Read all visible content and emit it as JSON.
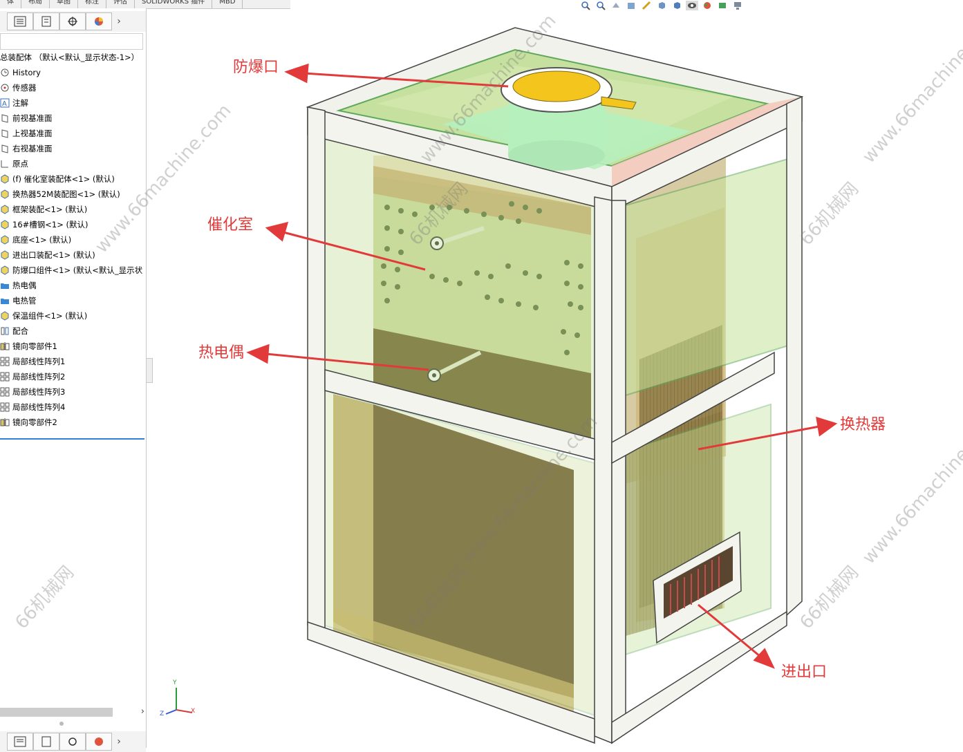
{
  "tabs": [
    "体",
    "布局",
    "草图",
    "标注",
    "评估",
    "SOLIDWORKS 插件",
    "MBD"
  ],
  "feature_tree": {
    "root": "总装配体 （默认<默认_显示状态-1>）",
    "items": [
      {
        "label": "History",
        "icon": "history-icon"
      },
      {
        "label": "传感器",
        "icon": "sensor-icon"
      },
      {
        "label": "注解",
        "icon": "annotation-icon"
      },
      {
        "label": "前视基准面",
        "icon": "plane-icon"
      },
      {
        "label": "上视基准面",
        "icon": "plane-icon"
      },
      {
        "label": "右视基准面",
        "icon": "plane-icon"
      },
      {
        "label": "原点",
        "icon": "origin-icon"
      },
      {
        "label": "(f) 催化室装配体<1> (默认)",
        "icon": "assembly-icon"
      },
      {
        "label": "换热器52M装配图<1> (默认)",
        "icon": "assembly-icon"
      },
      {
        "label": "框架装配<1> (默认)",
        "icon": "assembly-icon"
      },
      {
        "label": "16#槽钢<1> (默认)",
        "icon": "part-icon"
      },
      {
        "label": "底座<1> (默认)",
        "icon": "assembly-icon"
      },
      {
        "label": "进出口装配<1> (默认)",
        "icon": "assembly-icon"
      },
      {
        "label": "防爆口组件<1> (默认<默认_显示状",
        "icon": "assembly-icon"
      },
      {
        "label": "热电偶",
        "icon": "folder-icon"
      },
      {
        "label": "电热管",
        "icon": "folder-icon"
      },
      {
        "label": "保温组件<1> (默认)",
        "icon": "assembly-icon"
      },
      {
        "label": "配合",
        "icon": "mates-icon"
      },
      {
        "label": "镜向零部件1",
        "icon": "mirror-icon"
      },
      {
        "label": "局部线性阵列1",
        "icon": "pattern-icon"
      },
      {
        "label": "局部线性阵列2",
        "icon": "pattern-icon"
      },
      {
        "label": "局部线性阵列3",
        "icon": "pattern-icon"
      },
      {
        "label": "局部线性阵列4",
        "icon": "pattern-icon"
      },
      {
        "label": "镜向零部件2",
        "icon": "mirror-icon"
      }
    ]
  },
  "callouts": {
    "explosion_vent": "防爆口",
    "catalytic_chamber": "催化室",
    "thermocouple": "热电偶",
    "heat_exchanger": "换热器",
    "inlet_outlet": "进出口"
  },
  "triad": {
    "x": "X",
    "y": "Y",
    "z": "Z"
  },
  "watermark": {
    "domain": "www.66machine.com",
    "brand": "66机械网"
  },
  "colors": {
    "callout": "#e23a3a",
    "frame": "#f4f4ef",
    "glass": "#cfe6a4",
    "panel_brown": "#6b5732",
    "vent_yellow": "#f3c51d"
  }
}
